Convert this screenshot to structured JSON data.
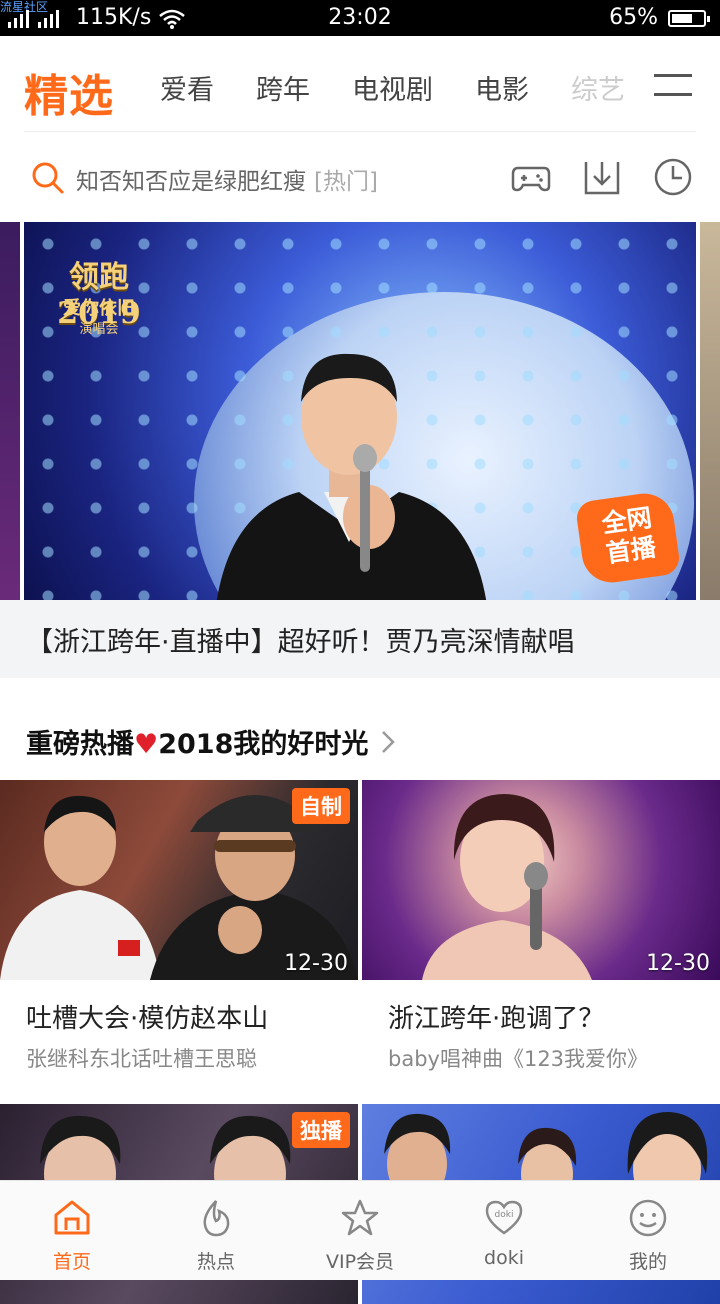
{
  "status_bar": {
    "watermark": "流星社区",
    "network": "2G",
    "speed": "115K/s",
    "time": "23:02",
    "battery": "65%",
    "battery_level": 0.65
  },
  "top_nav": {
    "active_tab": "精选",
    "tabs": [
      "爱看",
      "跨年",
      "电视剧",
      "电影",
      "综艺"
    ],
    "accent_color": "#ff6a1a"
  },
  "search": {
    "query": "知否知否应是绿肥红瘦",
    "tag": "[热门]"
  },
  "banner": {
    "logo_line1": "领跑2019",
    "logo_line2": "爱你依旧",
    "logo_line3": "演唱会",
    "badge": "全网首播",
    "caption": "【浙江跨年·直播中】超好听！贾乃亮深情献唱"
  },
  "section": {
    "title_before": "重磅热播",
    "title_after": "2018我的好时光"
  },
  "cards": [
    {
      "badge": "自制",
      "date": "12-30",
      "title": "吐槽大会·模仿赵本山",
      "subtitle": "张继科东北话吐槽王思聪"
    },
    {
      "badge": "",
      "date": "12-30",
      "title": "浙江跨年·跑调了？",
      "subtitle": "baby唱神曲《123我爱你》"
    },
    {
      "badge": "独播",
      "date": "",
      "title": "",
      "subtitle": ""
    },
    {
      "badge": "",
      "date": "",
      "title": "",
      "subtitle": ""
    }
  ],
  "tab_bar": [
    {
      "label": "首页",
      "icon": "home-icon",
      "active": true
    },
    {
      "label": "热点",
      "icon": "flame-icon",
      "active": false
    },
    {
      "label": "VIP会员",
      "icon": "vip-crown-icon",
      "active": false
    },
    {
      "label": "doki",
      "icon": "doki-heart-icon",
      "active": false
    },
    {
      "label": "我的",
      "icon": "smiley-icon",
      "active": false
    }
  ]
}
